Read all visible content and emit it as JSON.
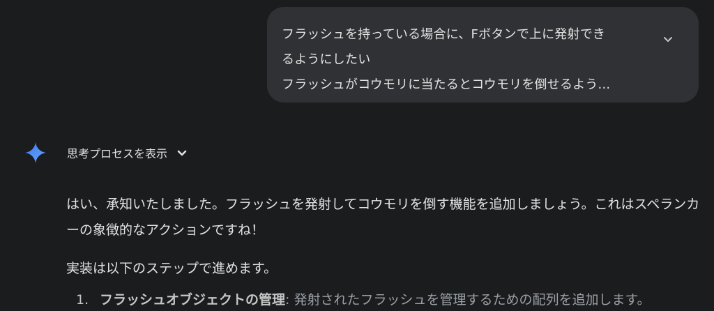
{
  "user_message": {
    "lines": [
      "フラッシュを持っている場合に、Fボタンで上に発射でき",
      "るようにしたい",
      "フラッシュがコウモリに当たるとコウモリを倒せるよう..."
    ],
    "expand_icon": "chevron-down-icon"
  },
  "thinking": {
    "icon": "gemini-spark-icon",
    "label": "思考プロセスを表示",
    "chevron_icon": "chevron-down-icon",
    "spark_color": "#4b8ef5"
  },
  "response": {
    "paragraphs": [
      "はい、承知いたしました。フラッシュを発射してコウモリを倒す機能を追加しましょう。これはスペランカーの象徴的なアクションですね！",
      "実装は以下のステップで進めます。"
    ],
    "list": [
      {
        "number": "1.",
        "title": "フラッシュオブジェクトの管理",
        "text": ": 発射されたフラッシュを管理するための配列を追加します。"
      }
    ]
  },
  "colors": {
    "background": "#1b1c1e",
    "bubble": "#303134",
    "text": "#e3e3e3"
  }
}
